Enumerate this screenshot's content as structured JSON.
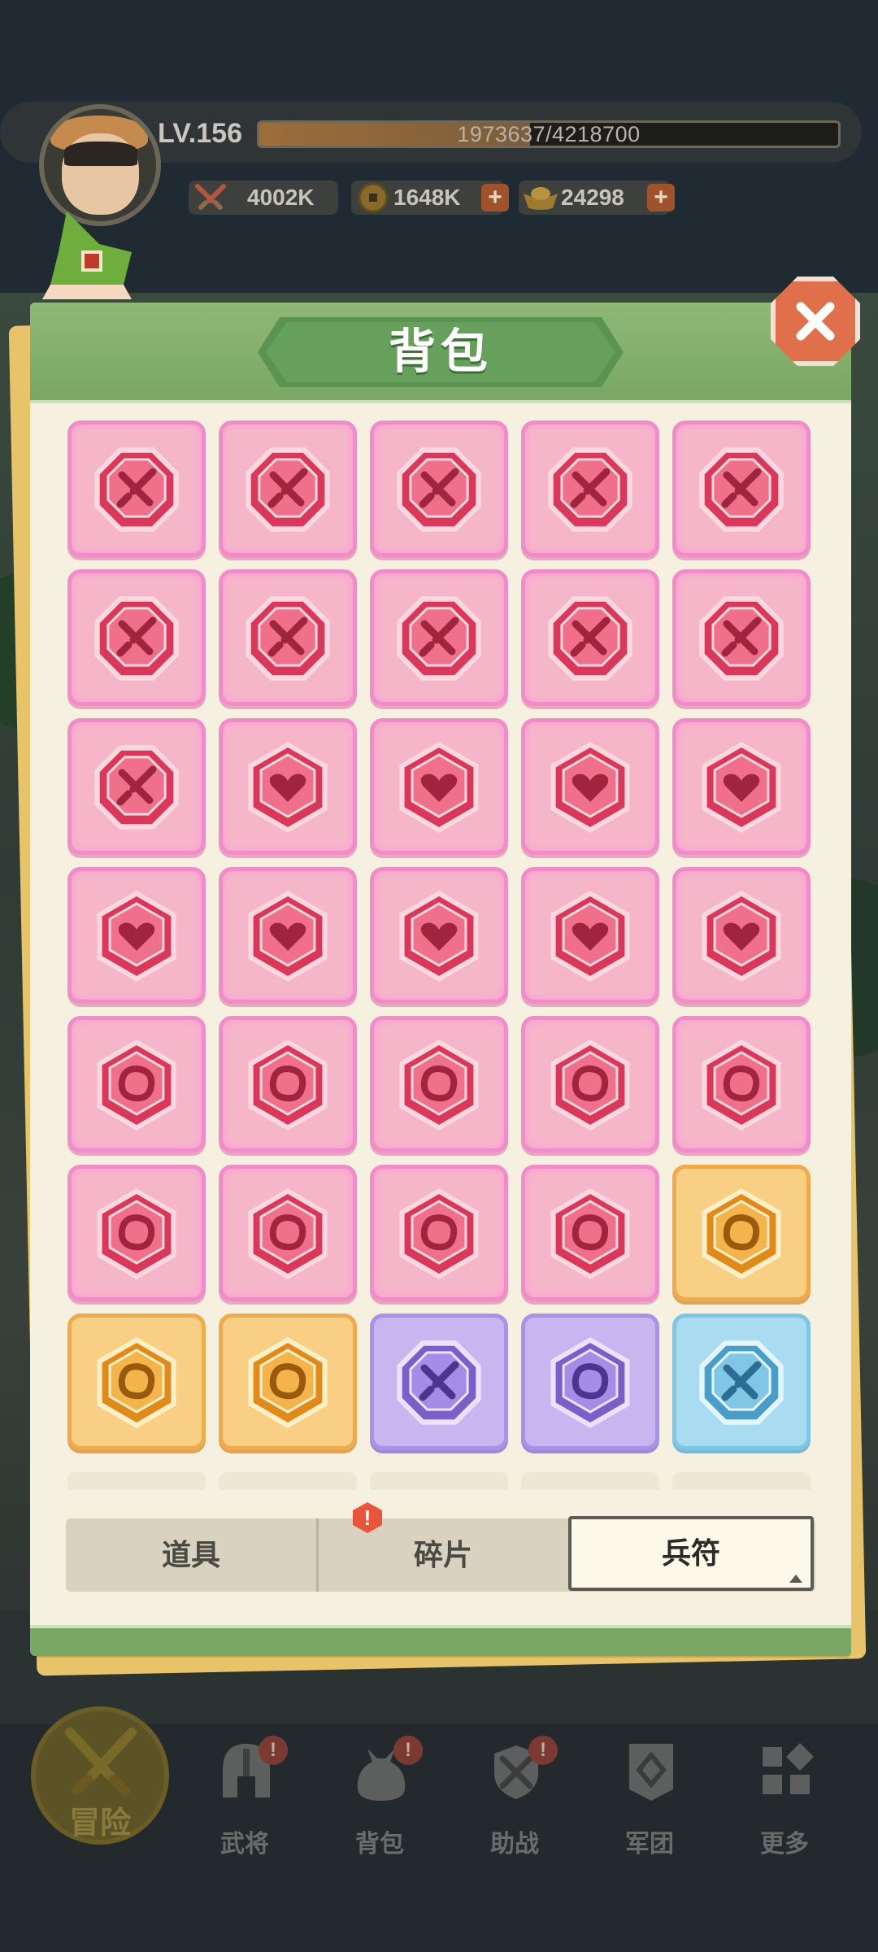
{
  "player": {
    "level": "LV.156",
    "exp_text": "1973637/4218700",
    "exp_fraction": 0.468
  },
  "resources": {
    "power": "4002K",
    "coins": "1648K",
    "gold": "24298",
    "plus": "+"
  },
  "panel": {
    "title": "背包"
  },
  "grid": {
    "rows": [
      [
        "pink-sword",
        "pink-sword",
        "pink-sword",
        "pink-sword",
        "pink-sword"
      ],
      [
        "pink-sword",
        "pink-sword",
        "pink-sword",
        "pink-sword",
        "pink-sword"
      ],
      [
        "pink-sword",
        "pink-heart",
        "pink-heart",
        "pink-heart",
        "pink-heart"
      ],
      [
        "pink-heart",
        "pink-heart",
        "pink-heart",
        "pink-heart",
        "pink-heart"
      ],
      [
        "pink-swirl",
        "pink-swirl",
        "pink-swirl",
        "pink-swirl",
        "pink-swirl"
      ],
      [
        "pink-swirl",
        "pink-swirl",
        "pink-swirl",
        "pink-swirl",
        "orange-swirl"
      ],
      [
        "orange-swirl",
        "orange-swirl",
        "purple-sword",
        "purple-swirl",
        "blue-sword"
      ]
    ]
  },
  "tabs": [
    {
      "label": "道具"
    },
    {
      "label": "碎片"
    },
    {
      "label": "兵符"
    }
  ],
  "tab_alert": "!",
  "nav": [
    {
      "label": "冒险",
      "icon": "crossed-swords-icon"
    },
    {
      "label": "武将",
      "icon": "helmet-icon",
      "badge": "!"
    },
    {
      "label": "背包",
      "icon": "bag-icon",
      "badge": "!"
    },
    {
      "label": "助战",
      "icon": "sword-shield-icon",
      "badge": "!"
    },
    {
      "label": "军团",
      "icon": "banner-icon"
    },
    {
      "label": "更多",
      "icon": "grid-icon"
    }
  ],
  "colors": {
    "panel_green": "#7aa763",
    "pink_rarity": "#f6b6c9",
    "orange_rarity": "#f9cf86",
    "purple_rarity": "#c7b6ef",
    "blue_rarity": "#a9dcf0"
  }
}
